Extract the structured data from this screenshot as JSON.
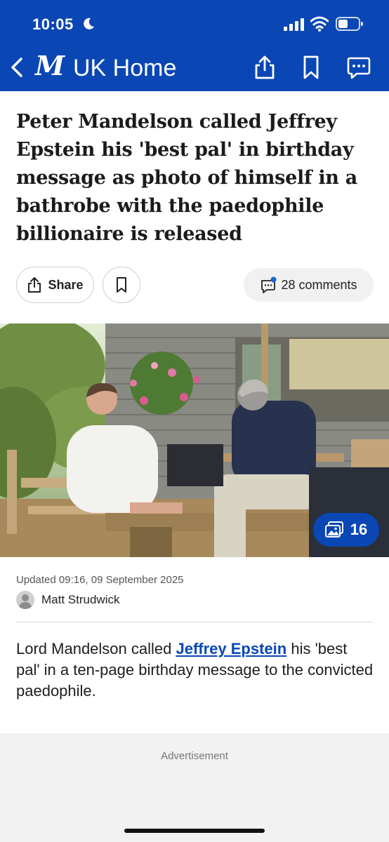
{
  "status_bar": {
    "time": "10:05"
  },
  "nav": {
    "title": "UK Home"
  },
  "article": {
    "headline": "Peter Mandelson called Jeffrey Epstein his 'best pal' in birthday message as photo of himself in a bathrobe with the paedophile billionaire is released",
    "share_label": "Share",
    "comments_label": "28 comments",
    "gallery_count": "16",
    "updated": "Updated 09:16, 09 September 2025",
    "author": "Matt Strudwick",
    "body": {
      "before_link": "Lord Mandelson called ",
      "link_text": "Jeffrey Epstein",
      "after_link": " his 'best pal' in a ten-page birthday message to the convicted paedophile."
    }
  },
  "ad": {
    "label": "Advertisement"
  },
  "colors": {
    "brand_blue": "#0a47b5",
    "notification_dot": "#1565d8"
  }
}
